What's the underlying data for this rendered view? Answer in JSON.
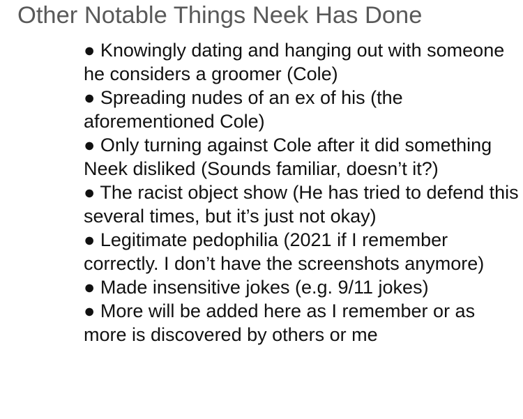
{
  "title": "Other Notable Things Neek Has Done",
  "bullet_symbol": "●",
  "items": [
    {
      "text": "Knowingly dating and hanging out with someone he considers a groomer (Cole)"
    },
    {
      "text": "Spreading nudes of an ex of his (the aforementioned Cole)"
    },
    {
      "text": "Only turning against Cole after it did something Neek disliked (Sounds familiar, doesn’t it?)"
    },
    {
      "text": "The racist object show (He has tried to defend this several times, but it’s just not okay)"
    },
    {
      "text": "Legitimate pedophilia (2021 if I remember correctly. I don’t have the screenshots anymore)"
    },
    {
      "text": "Made insensitive jokes (e.g. 9/11 jokes)"
    },
    {
      "text": "More will be added here as I remember or as more is discovered by others or me"
    }
  ],
  "colors": {
    "title": "#595959",
    "body_text": "#111111",
    "background": "#ffffff"
  }
}
